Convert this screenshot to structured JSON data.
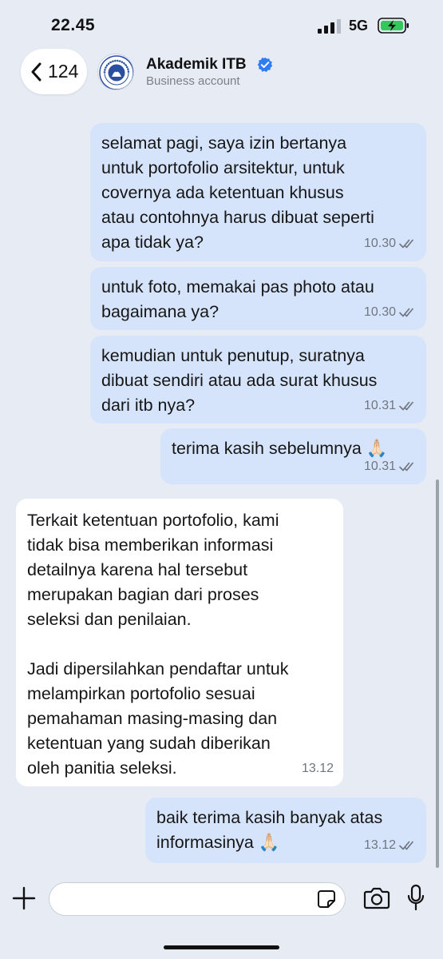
{
  "status_bar": {
    "time": "22.45",
    "network": "5G"
  },
  "header": {
    "back_count": "124",
    "contact_name": "Akademik ITB",
    "contact_subtitle": "Business account"
  },
  "messages": [
    {
      "direction": "outgoing",
      "text": "selamat pagi, saya izin bertanya\nuntuk portofolio arsitektur, untuk\ncovernya ada ketentuan khusus\natau contohnya harus dibuat seperti\napa tidak ya?",
      "time": "10.30",
      "status": "read"
    },
    {
      "direction": "outgoing",
      "text": "untuk foto, memakai pas photo atau\nbagaimana ya?",
      "time": "10.30",
      "status": "read"
    },
    {
      "direction": "outgoing",
      "text": "kemudian untuk penutup, suratnya\ndibuat sendiri atau ada surat khusus\ndari itb nya?",
      "time": "10.31",
      "status": "read"
    },
    {
      "direction": "outgoing",
      "text": "terima kasih sebelumnya 🙏🏻",
      "time": "10.31",
      "status": "read"
    },
    {
      "direction": "incoming",
      "text": "Terkait ketentuan portofolio, kami\ntidak bisa memberikan informasi\ndetailnya karena hal tersebut\nmerupakan bagian dari proses\nseleksi dan penilaian.\n\nJadi dipersilahkan pendaftar untuk\nmelampirkan portofolio sesuai\npemahaman masing-masing dan\nketentuan yang sudah diberikan\noleh panitia seleksi.",
      "time": "13.12"
    },
    {
      "direction": "outgoing",
      "text": "baik terima kasih banyak atas\ninformasinya 🙏🏻",
      "time": "13.12",
      "status": "read"
    }
  ],
  "composer": {
    "value": "",
    "placeholder": ""
  },
  "icons": {
    "back": "chevron-left-icon",
    "verified": "verified-badge-icon",
    "read_receipt": "double-check-icon",
    "plus": "plus-icon",
    "sticker": "sticker-icon",
    "camera": "camera-icon",
    "microphone": "microphone-icon"
  },
  "colors": {
    "background": "#e6ebf4",
    "outgoing_bubble": "#d6e4fb",
    "incoming_bubble": "#ffffff",
    "verified_badge": "#2f7cf6",
    "battery_charging": "#34c759"
  }
}
